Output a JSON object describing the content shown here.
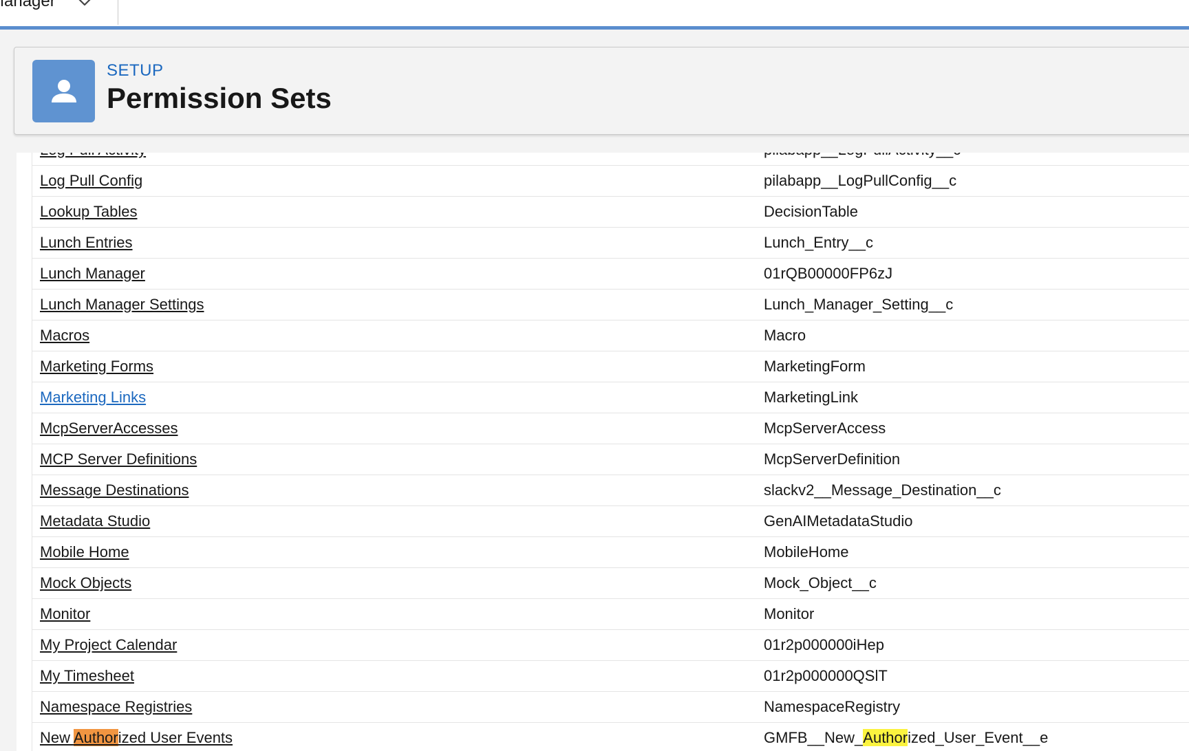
{
  "topbar": {
    "app_name": "Manager"
  },
  "header": {
    "overline": "SETUP",
    "title": "Permission Sets"
  },
  "rows": [
    {
      "label": "Log Pull Activity",
      "api_name": "pilabapp__LogPullActivity__c"
    },
    {
      "label": "Log Pull Config",
      "api_name": "pilabapp__LogPullConfig__c"
    },
    {
      "label": "Lookup Tables",
      "api_name": "DecisionTable"
    },
    {
      "label": "Lunch Entries",
      "api_name": "Lunch_Entry__c"
    },
    {
      "label": "Lunch Manager",
      "api_name": "01rQB00000FP6zJ"
    },
    {
      "label": "Lunch Manager Settings",
      "api_name": "Lunch_Manager_Setting__c"
    },
    {
      "label": "Macros",
      "api_name": "Macro"
    },
    {
      "label": "Marketing Forms",
      "api_name": "MarketingForm"
    },
    {
      "label": "Marketing Links",
      "api_name": "MarketingLink",
      "visited": true
    },
    {
      "label": "McpServerAccesses",
      "api_name": "McpServerAccess"
    },
    {
      "label": "MCP Server Definitions",
      "api_name": "McpServerDefinition"
    },
    {
      "label": "Message Destinations",
      "api_name": "slackv2__Message_Destination__c"
    },
    {
      "label": "Metadata Studio",
      "api_name": "GenAIMetadataStudio"
    },
    {
      "label": "Mobile Home",
      "api_name": "MobileHome"
    },
    {
      "label": "Mock Objects",
      "api_name": "Mock_Object__c"
    },
    {
      "label": "Monitor",
      "api_name": "Monitor"
    },
    {
      "label": "My Project Calendar",
      "api_name": "01r2p000000iHep"
    },
    {
      "label": "My Timesheet",
      "api_name": "01r2p000000QSlT"
    },
    {
      "label": "Namespace Registries",
      "api_name": "NamespaceRegistry"
    }
  ],
  "last_row": {
    "label_before": "New ",
    "label_match": "Author",
    "label_after": "ized User Events",
    "api_before": "GMFB__New_",
    "api_match": "Author",
    "api_after": "ized_User_Event__e"
  },
  "colors": {
    "accent": "#5a8dce",
    "link_visited": "#1b68bf",
    "highlight_current": "#f19541",
    "highlight_match": "#fbf33f"
  },
  "icons": {
    "header_icon": "user-icon",
    "app_menu": "chevron-down-icon"
  }
}
